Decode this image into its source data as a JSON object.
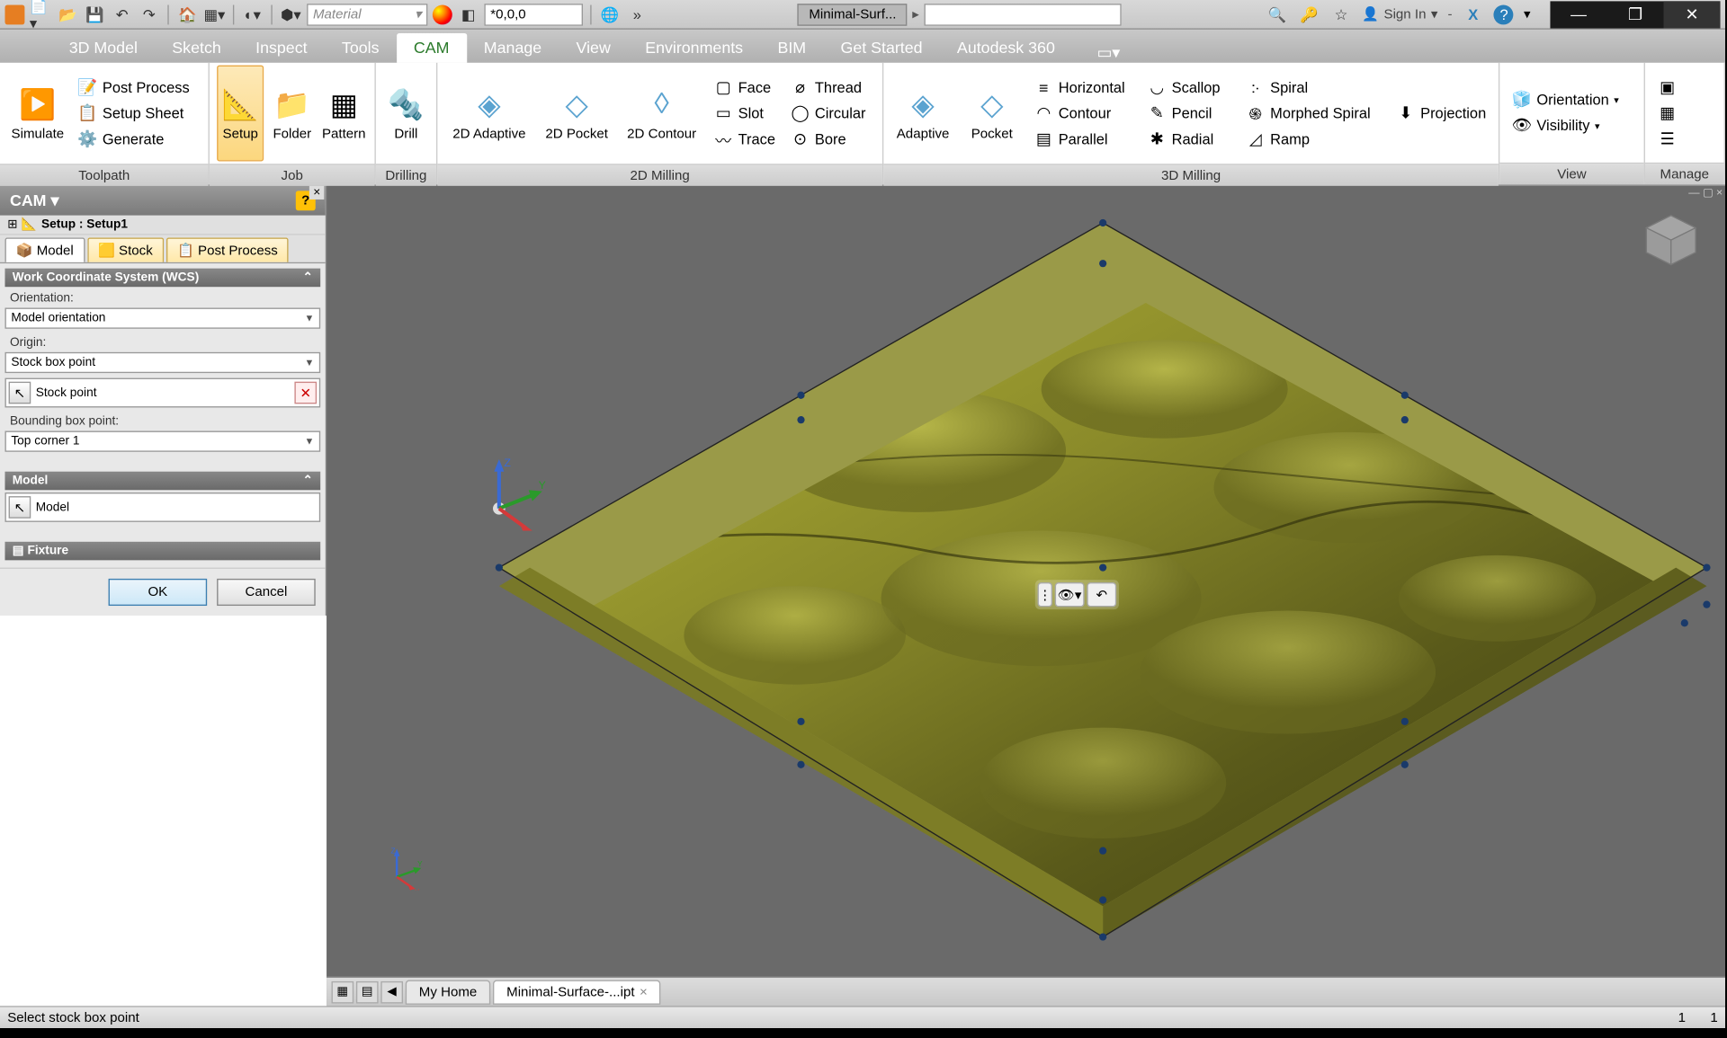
{
  "titlebar": {
    "material_placeholder": "Material",
    "coords": "*0,0,0",
    "doc_title": "Minimal-Surf...",
    "signin": "Sign In"
  },
  "main_tabs": [
    "3D Model",
    "Sketch",
    "Inspect",
    "Tools",
    "CAM",
    "Manage",
    "View",
    "Environments",
    "BIM",
    "Get Started",
    "Autodesk 360"
  ],
  "main_tab_active": 4,
  "ribbon": {
    "toolpath": {
      "title": "Toolpath",
      "simulate": "Simulate",
      "post_process": "Post Process",
      "setup_sheet": "Setup Sheet",
      "generate": "Generate"
    },
    "job": {
      "title": "Job",
      "setup": "Setup",
      "folder": "Folder",
      "pattern": "Pattern"
    },
    "drilling": {
      "title": "Drilling",
      "drill": "Drill"
    },
    "milling2d": {
      "title": "2D Milling",
      "adaptive": "2D Adaptive",
      "pocket": "2D Pocket",
      "contour": "2D Contour",
      "face": "Face",
      "slot": "Slot",
      "trace": "Trace",
      "thread": "Thread",
      "circular": "Circular",
      "bore": "Bore"
    },
    "milling3d": {
      "title": "3D Milling",
      "adaptive": "Adaptive",
      "pocket": "Pocket",
      "horizontal": "Horizontal",
      "contour": "Contour",
      "parallel": "Parallel",
      "scallop": "Scallop",
      "pencil": "Pencil",
      "radial": "Radial",
      "spiral": "Spiral",
      "morphed": "Morphed Spiral",
      "ramp": "Ramp",
      "projection": "Projection"
    },
    "view": {
      "title": "View",
      "orientation": "Orientation",
      "visibility": "Visibility"
    },
    "manage": {
      "title": "Manage"
    }
  },
  "side": {
    "title": "CAM",
    "setup_label": "Setup : Setup1",
    "tabs": {
      "model": "Model",
      "stock": "Stock",
      "post": "Post Process"
    },
    "wcs": {
      "header": "Work Coordinate System (WCS)",
      "orientation_label": "Orientation:",
      "orientation_value": "Model orientation",
      "origin_label": "Origin:",
      "origin_value": "Stock box point",
      "stock_point": "Stock point",
      "bbox_label": "Bounding box point:",
      "bbox_value": "Top corner 1"
    },
    "model": {
      "header": "Model",
      "label": "Model"
    },
    "fixture": {
      "header": "Fixture"
    },
    "ok": "OK",
    "cancel": "Cancel"
  },
  "viewport": {
    "axes": {
      "x": "X",
      "y": "Y",
      "z": "Z"
    }
  },
  "doc_tabs": {
    "home": "My Home",
    "file": "Minimal-Surface-...ipt"
  },
  "status": {
    "msg": "Select stock box point",
    "n1": "1",
    "n2": "1"
  }
}
